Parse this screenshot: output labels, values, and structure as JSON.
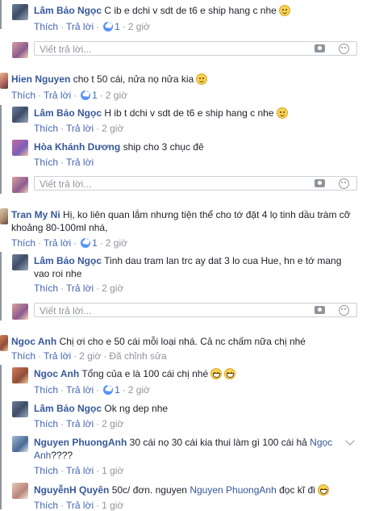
{
  "action_labels": {
    "like": "Thích",
    "reply": "Trả lời",
    "edited": "Đã chỉnh sửa",
    "separator": "·"
  },
  "reply_placeholder": "Viết trả lời...",
  "comments": [
    {
      "name": "Lâm Bảo Ngọc",
      "text": "C ib e dchi v sdt de t6 e ship hang c nhe",
      "likes": "1",
      "time": "2 giờ"
    },
    {
      "name": "Hien Nguyen",
      "text": "cho t 50 cái, nửa nọ nửa kia",
      "likes": "1",
      "time": "2 giờ"
    },
    {
      "name": "Lâm Bảo Ngọc",
      "text": "H ib t dchi v sdt de t6 e ship hang c nhe",
      "time": "2 giờ"
    },
    {
      "name": "Hòa Khánh Dương",
      "text": "ship cho 3 chục đê",
      "time": ""
    },
    {
      "name": "Tran My Ni",
      "text": "Hị, ko liên quan lắm nhưng tiện thể cho tớ đặt 4 lọ tinh dầu tràm cỡ",
      "text2": "khoảng 80-100ml nhá,",
      "likes": "1",
      "time": "2 giờ"
    },
    {
      "name": "Lâm Bảo Ngọc",
      "text": "Tinh dau tram lan trc ay dat 3 lo cua Hue, hn e tớ mang",
      "text2": "vao roi nhe",
      "time": "2 giờ"
    },
    {
      "name": "Ngoc Anh",
      "text": "Chị ơi cho e 50 cái mỗi loại nhá. Cả nc chấm nữa chị nhé",
      "time": "2 giờ"
    },
    {
      "name": "Ngoc Anh",
      "text": "Tổng của e là 100 cái chị nhé",
      "likes": "1",
      "time": "2 giờ"
    },
    {
      "name": "Lâm Bảo Ngọc",
      "text": "Ok ng dep nhe",
      "time": "2 giờ"
    },
    {
      "name": "Nguyen PhuongAnh",
      "text": "30 cái nọ 30 cái kia thui làm gì 100 cái hả",
      "mention": "Ngọc",
      "text2_mention": "Anh",
      "text2": "????",
      "time": "1 giờ"
    },
    {
      "name": "NguyễnH Quyên",
      "text_before": "50c/ đơn. nguyen",
      "mention": "Nguyen PhuongAnh",
      "text": "đọc kĩ đi",
      "time": "1 giờ"
    }
  ]
}
